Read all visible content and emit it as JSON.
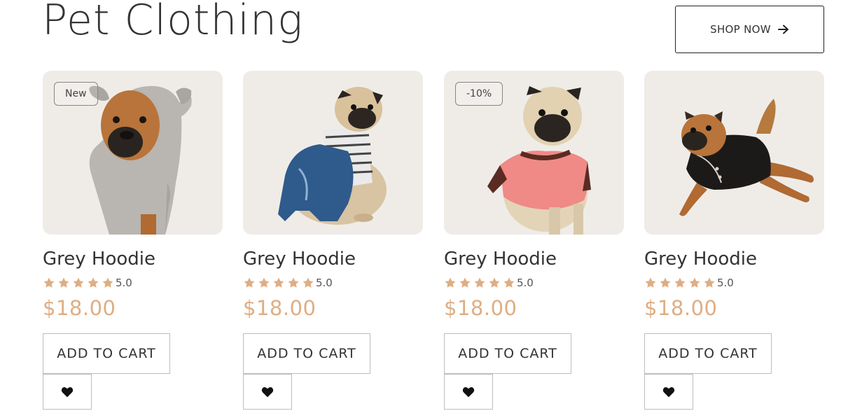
{
  "header": {
    "title": "Pet Clothing",
    "shop_now_label": "SHOP NOW",
    "shop_now_icon": "arrow-right-icon"
  },
  "colors": {
    "accent_price": "#dfae83",
    "star": "#dfae83",
    "card_bg": "#efece8"
  },
  "products": [
    {
      "badge": "New",
      "name": "Grey Hoodie",
      "rating": "5.0",
      "stars": 5,
      "price": "$18.00",
      "add_to_cart_label": "ADD TO CART",
      "wishlist_icon": "heart-icon",
      "image": "pug in grey hoodie"
    },
    {
      "badge": "",
      "name": "Grey Hoodie",
      "rating": "5.0",
      "stars": 5,
      "price": "$18.00",
      "add_to_cart_label": "ADD TO CART",
      "wishlist_icon": "heart-icon",
      "image": "pug in denim overalls"
    },
    {
      "badge": "-10%",
      "name": "Grey Hoodie",
      "rating": "5.0",
      "stars": 5,
      "price": "$18.00",
      "add_to_cart_label": "ADD TO CART",
      "wishlist_icon": "heart-icon",
      "image": "pug in pink shirt"
    },
    {
      "badge": "",
      "name": "Grey Hoodie",
      "rating": "5.0",
      "stars": 5,
      "price": "$18.00",
      "add_to_cart_label": "ADD TO CART",
      "wishlist_icon": "heart-icon",
      "image": "dog in black shirt jumping"
    }
  ]
}
